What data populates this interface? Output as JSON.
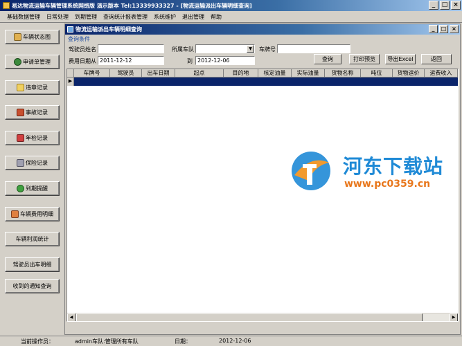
{
  "window": {
    "title": "易达物流运输车辆管理系统网络版 演示版本  Tel:13339933327  - [物流运输派出车辆明细查询]",
    "minimize": "_",
    "restore": "□",
    "close": "×"
  },
  "menu": [
    "基础数据管理",
    "日常处理",
    "到期管理",
    "查询统计报表管理",
    "系统维护",
    "退出管理",
    "帮助"
  ],
  "sidebar": {
    "items": [
      {
        "label": "车辆状态图",
        "icon": "car-status-icon"
      },
      {
        "label": "申请单管理",
        "icon": "application-icon"
      },
      {
        "label": "违章记录",
        "icon": "violation-icon"
      },
      {
        "label": "事故记录",
        "icon": "accident-icon"
      },
      {
        "label": "年检记录",
        "icon": "inspection-icon"
      },
      {
        "label": "保险记录",
        "icon": "insurance-icon"
      },
      {
        "label": "到期提醒",
        "icon": "reminder-icon"
      },
      {
        "label": "车辆费用明细",
        "icon": "expense-icon"
      },
      {
        "label": "车辆利润统计",
        "icon": ""
      },
      {
        "label": "驾驶员出车明细",
        "icon": ""
      },
      {
        "label": "收到的通知查询",
        "icon": ""
      }
    ]
  },
  "inner": {
    "title": "物流运输派出车辆明细查询",
    "minimize": "_",
    "restore": "□",
    "close": "×",
    "query_legend": "查询条件",
    "driver_label": "驾驶员姓名",
    "driver_value": "",
    "team_label": "所属车队",
    "team_value": "",
    "plate_label": "车牌号",
    "plate_value": "",
    "date_from_label": "费用日期从",
    "date_from": "2011-12-12",
    "date_to_label": "到",
    "date_to": "2012-12-06",
    "buttons": {
      "query": "查询",
      "print": "打印预览",
      "excel": "导出Excel",
      "back": "返回"
    }
  },
  "grid": {
    "columns": [
      "车牌号",
      "驾驶员",
      "出车日期",
      "起点",
      "目的地",
      "核定油量",
      "实际油量",
      "货物名称",
      "吨位",
      "货物运价",
      "运费收入"
    ],
    "row_indicator": "▶"
  },
  "status": {
    "operator_label": "当前操作员：",
    "operator_value": "admin车队:管理所有车队",
    "date_label": "日期：",
    "date_value": "2012-12-06"
  },
  "watermark": {
    "site_name": "河东下载站",
    "url": "www.pc0359.cn"
  }
}
